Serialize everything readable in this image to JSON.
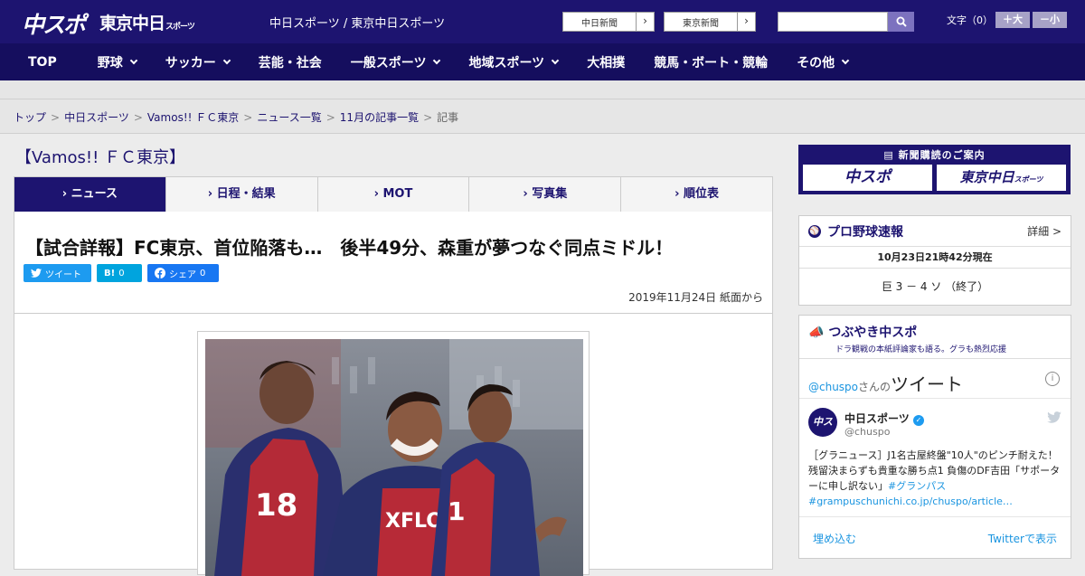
{
  "header": {
    "logo_main": "中スポ",
    "logo_tokyo": "東京中日",
    "logo_tokyo_small": "スポーツ",
    "site_name": "中日スポーツ / 東京中日スポーツ",
    "paper_buttons": [
      "中日新聞",
      "東京新聞"
    ],
    "font_size_label": "文字（0）",
    "font_plus": "＋大",
    "font_minus": "－小",
    "search_placeholder": ""
  },
  "nav": {
    "items": [
      {
        "label": "TOP",
        "dropdown": false
      },
      {
        "label": "野球",
        "dropdown": true
      },
      {
        "label": "サッカー",
        "dropdown": true
      },
      {
        "label": "芸能・社会",
        "dropdown": false
      },
      {
        "label": "一般スポーツ",
        "dropdown": true
      },
      {
        "label": "地域スポーツ",
        "dropdown": true
      },
      {
        "label": "大相撲",
        "dropdown": false
      },
      {
        "label": "競馬・ボート・競輪",
        "dropdown": false
      },
      {
        "label": "その他",
        "dropdown": true
      }
    ]
  },
  "breadcrumb": {
    "items": [
      "トップ",
      "中日スポーツ",
      "Vamos!! ＦＣ東京",
      "ニュース一覧",
      "11月の記事一覧"
    ],
    "current": "記事",
    "separator": ">"
  },
  "section_title": "【Vamos!! ＦＣ東京】",
  "tabs": [
    {
      "label": "ニュース",
      "active": true
    },
    {
      "label": "日程・結果",
      "active": false
    },
    {
      "label": "MOT",
      "active": false
    },
    {
      "label": "写真集",
      "active": false
    },
    {
      "label": "順位表",
      "active": false
    }
  ],
  "article": {
    "title": "【試合詳報】FC東京、首位陥落も…　後半49分、森重が夢つなぐ同点ミドル！",
    "share": {
      "tweet": "ツイート",
      "hatena": "B!",
      "hatena_count": "0",
      "facebook": "シェア",
      "facebook_count": "0"
    },
    "date": "2019年11月24日 紙面から"
  },
  "sidebar": {
    "ad": {
      "title": "新聞購読のご案内",
      "buttons": [
        "中スポ",
        "東京中日"
      ],
      "tokyo_small": "スポーツ"
    },
    "baseball": {
      "title": "プロ野球速報",
      "more": "詳細 >",
      "time": "10月23日21時42分現在",
      "score": "巨  3 － 4  ソ  （終了）"
    },
    "tweets": {
      "title": "つぶやき中スポ",
      "subtitle": "ドラ観戦の本紙評論家も語る。グラも熱烈応援",
      "handle_prefix": "@chuspo",
      "handle_suffix": "さんの",
      "tweets_label": "ツイート",
      "account_name": "中日スポーツ",
      "account_handle": "@chuspo",
      "text": "［グラニュース］J1名古屋終盤\"10人\"のピンチ耐えた！残留決まらずも貴重な勝ち点1 負傷のDF吉田「サポーターに申し訳ない」",
      "hashtag": "#グランパス",
      "link": "#grampuschunichi.co.jp/chuspo/article…",
      "embed": "埋め込む",
      "view_on_twitter": "Twitterで表示"
    }
  },
  "colors": {
    "brand": "#1d1470",
    "nav": "#150e5e",
    "twitter": "#1d9bf0",
    "facebook": "#1877f2",
    "hatena": "#00a4de"
  }
}
